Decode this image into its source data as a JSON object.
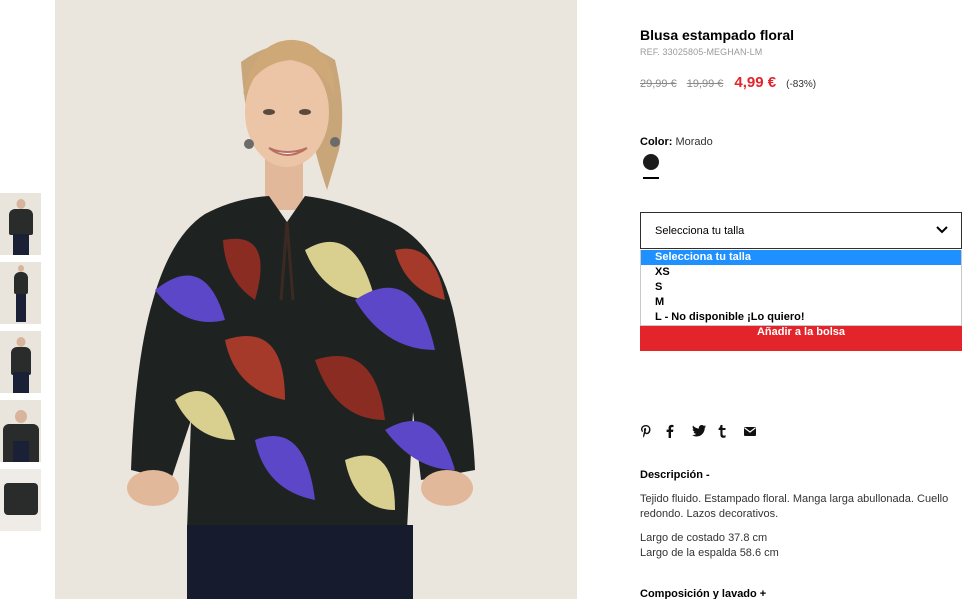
{
  "product": {
    "title": "Blusa estampado floral",
    "ref": "REF. 33025805-MEGHAN-LM",
    "price_original": "29,99 €",
    "price_previous": "19,99 €",
    "price_current": "4,99 €",
    "discount": "(-83%)"
  },
  "color": {
    "label": "Color:",
    "value": "Morado",
    "swatch_hex": "#1b1b1b"
  },
  "size_select": {
    "placeholder": "Selecciona tu talla",
    "options": [
      "Selecciona tu talla",
      "XS",
      "S",
      "M",
      "L - No disponible ¡Lo quiero!"
    ],
    "selected_index": 0
  },
  "cart": {
    "add_label": "Añadir a la bolsa"
  },
  "share": {
    "icons": [
      "pinterest-icon",
      "facebook-icon",
      "twitter-icon",
      "tumblr-icon",
      "email-icon"
    ]
  },
  "description": {
    "heading": "Descripción -",
    "text": "Tejido fluido. Estampado floral. Manga larga abullonada. Cuello redondo. Lazos decorativos.",
    "measure_1": "Largo de costado 37.8 cm",
    "measure_2": "Largo de la espalda 58.6 cm"
  },
  "composition": {
    "heading": "Composición y lavado +"
  },
  "colors": {
    "accent_red": "#e3242b",
    "select_highlight": "#1e90ff",
    "image_bg": "#ebe6dd"
  }
}
